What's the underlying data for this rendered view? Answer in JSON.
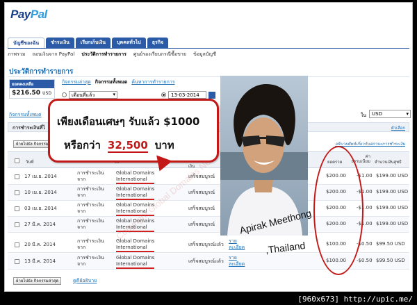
{
  "logo": {
    "part1": "Pay",
    "part2": "Pal"
  },
  "tabs": [
    {
      "label": "บัญชีของฉัน",
      "active": true
    },
    {
      "label": "ชำระเงิน"
    },
    {
      "label": "เรียกเก็บเงิน"
    },
    {
      "label": "บุคคลทั่วไป"
    },
    {
      "label": "ธุรกิจ"
    }
  ],
  "subnav": [
    {
      "label": "ภาพรวม"
    },
    {
      "label": "ถอนเงินจาก PayPal"
    },
    {
      "label": "ประวัติการทำรายการ",
      "active": true
    },
    {
      "label": "ศูนย์รองเรียนกรณีซื้อขาย"
    },
    {
      "label": "ข้อมูลบัญชี"
    }
  ],
  "page_title": "ประวัติการทำรายการ",
  "balance": {
    "header": "ยอดคงเหลือ",
    "amount": "$216.50",
    "currency": "USD"
  },
  "filter_tabs": [
    {
      "label": "กิจกรรมล่าสุด",
      "link": true
    },
    {
      "label": "กิจกรรมทั้งหมด",
      "active": true
    },
    {
      "label": "ค้นหาการทำรายการ",
      "link": true
    }
  ],
  "filter": {
    "period_select": "เดือนที่แล้ว",
    "date_value": "13-03-2014"
  },
  "advanced_link": "กิจกรรมทั้งหมด",
  "currency": {
    "label": "ใน",
    "value": "USD"
  },
  "section": {
    "title": "การชำระเงินที่ไ",
    "link_right": "ตัวเลือก",
    "link_right2": "อธิบายศัพท์เกี่ยวกับสถานะการชำระเงิน"
  },
  "buttons": {
    "archive_top": "ย้ายไปยัง กิจกรรมล่าสุด",
    "archive_bottom": "ย้ายไปยัง กิจกรรมล่าสุด",
    "bottom_link": "ดูคีย์อธิบาย"
  },
  "table": {
    "headers": {
      "date": "วันที่",
      "to": "ถึง",
      "status": "เงิน",
      "gross": "ยอดรวม",
      "fee": "ค่าธรรมเนียม",
      "net": "จำนวนเงินสุทธิ"
    },
    "rows": [
      {
        "date": "17 เม.ย. 2014",
        "type": "การชำระเงิน จาก",
        "name1": "Global Domains",
        "name2": "International",
        "status": "เสร็จสมบูรณ์",
        "gross": "$200.00",
        "fee": "-$1.00",
        "net": "$199.00 USD"
      },
      {
        "date": "10 เม.ย. 2014",
        "type": "การชำระเงิน จาก",
        "name1": "Global Domains",
        "name2": "International",
        "status": "เสร็จสมบูรณ์",
        "gross": "$200.00",
        "fee": "-$1.00",
        "net": "$199.00 USD"
      },
      {
        "date": "03 เม.ย. 2014",
        "type": "การชำระเงิน จาก",
        "name1": "Global Domains",
        "name2": "International",
        "status": "เสร็จสมบูรณ์",
        "gross": "$200.00",
        "fee": "-$1.00",
        "net": "$199.00 USD"
      },
      {
        "date": "27 มี.ค. 2014",
        "type": "การชำระเงิน จาก",
        "name1": "Global Domains",
        "name2": "International",
        "status": "เสร็จสมบูรณ์",
        "gross": "$200.00",
        "fee": "-$1.00",
        "net": "$199.00 USD"
      },
      {
        "date": "20 มี.ค. 2014",
        "type": "การชำระเงิน จาก",
        "name1": "Global Domains",
        "name2": "International",
        "status": "เสร็จสมบูรณ์แล้ว",
        "detail1": "ราย",
        "detail2": "ละเอียด",
        "gross": "$100.00",
        "fee": "-$0.50",
        "net": "$99.50 USD"
      },
      {
        "date": "13 มี.ค. 2014",
        "type": "การชำระเงิน จาก",
        "name1": "Global Domains",
        "name2": "International",
        "status": "เสร็จสมบูรณ์แล้ว",
        "detail1": "ราย",
        "detail2": "ละเอียด",
        "gross": "$100.00",
        "fee": "-$0.50",
        "net": "$99.50 USD"
      }
    ]
  },
  "callout": {
    "line1": "เพียงเดือนเศษๆ รับแล้ว $1000",
    "line2_pre": "หรือกว่า",
    "line2_num": "32,500",
    "line2_post": "บาท"
  },
  "person_name": "Apirak Meethong",
  "person_country": ",Thailand",
  "watermark": "Copyright Global Domains News",
  "footer": "[960x673] http://upic.me/",
  "colors": {
    "paypal_dark": "#1b3f86",
    "paypal_light": "#2d9be0",
    "tab_blue": "#2b5aa6",
    "callout_red": "#c31818"
  }
}
